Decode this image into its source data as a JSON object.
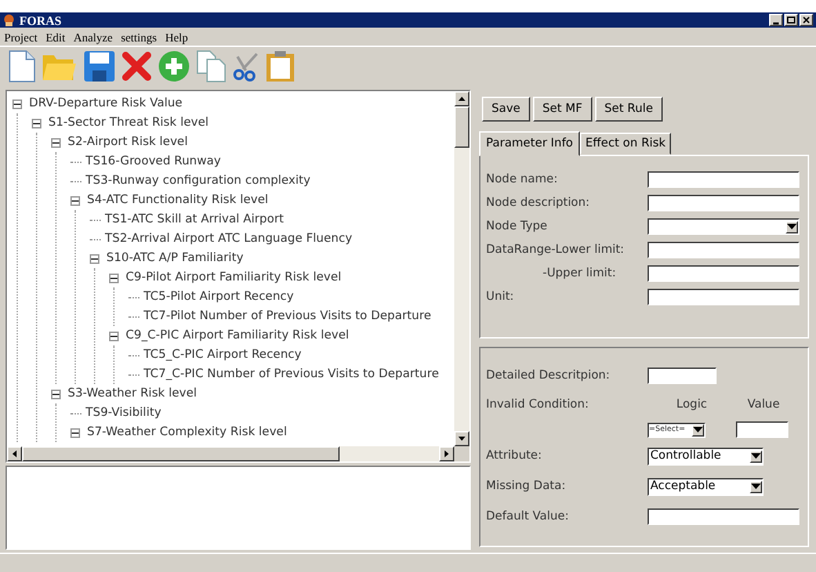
{
  "window": {
    "title": "FORAS"
  },
  "menu": [
    {
      "label": "Project"
    },
    {
      "label": "Edit"
    },
    {
      "label": "Analyze"
    },
    {
      "label": "settings"
    },
    {
      "label": "Help"
    }
  ],
  "tree": [
    {
      "label": "DRV-Departure Risk Value",
      "expanded": true,
      "children": [
        {
          "label": "S1-Sector Threat Risk level",
          "expanded": true,
          "children": [
            {
              "label": "S2-Airport Risk level",
              "expanded": true,
              "children": [
                {
                  "label": "TS16-Grooved Runway"
                },
                {
                  "label": "TS3-Runway configuration complexity"
                },
                {
                  "label": "S4-ATC Functionality Risk level",
                  "expanded": true,
                  "children": [
                    {
                      "label": "TS1-ATC Skill at Arrival Airport"
                    },
                    {
                      "label": "TS2-Arrival Airport ATC Language Fluency"
                    },
                    {
                      "label": "S10-ATC A/P Familiarity",
                      "expanded": true,
                      "children": [
                        {
                          "label": "C9-Pilot Airport Familiarity Risk level",
                          "expanded": true,
                          "children": [
                            {
                              "label": "TC5-Pilot Airport Recency"
                            },
                            {
                              "label": "TC7-Pilot Number of Previous Visits to Departure"
                            }
                          ]
                        },
                        {
                          "label": "C9_C-PIC Airport Familiarity Risk level",
                          "expanded": true,
                          "children": [
                            {
                              "label": "TC5_C-PIC Airport Recency"
                            },
                            {
                              "label": "TC7_C-PIC Number of Previous Visits to Departure"
                            }
                          ]
                        }
                      ]
                    }
                  ]
                }
              ]
            },
            {
              "label": "S3-Weather Risk level",
              "expanded": true,
              "children": [
                {
                  "label": "TS9-Visibility"
                },
                {
                  "label": "S7-Weather Complexity Risk level",
                  "expanded": true
                }
              ]
            }
          ]
        }
      ]
    }
  ],
  "actions": [
    "Save",
    "Set MF",
    "Set Rule"
  ],
  "tabs": [
    {
      "label": "Parameter Info",
      "selected": true
    },
    {
      "label": "Effect on Risk",
      "selected": false
    }
  ],
  "parameter_fields": [
    {
      "label": "Node name:",
      "kind": "text",
      "continuation": false
    },
    {
      "label": "Node description:",
      "kind": "text",
      "continuation": false
    },
    {
      "label": "Node Type",
      "kind": "select",
      "continuation": false
    },
    {
      "label": "DataRange-Lower limit:",
      "kind": "text",
      "continuation": false
    },
    {
      "label": "-Upper limit:",
      "kind": "text",
      "continuation": true
    },
    {
      "label": "Unit:",
      "kind": "text",
      "continuation": false
    }
  ],
  "details": [
    {
      "label": "Detailed Descritpion:",
      "kind": "short_text"
    },
    {
      "label": "Invalid Condition:",
      "kind": "condition",
      "logic_header": "Logic",
      "value_header": "Value",
      "logic_value": "=Select="
    },
    {
      "label": "Attribute:",
      "kind": "select",
      "value": "Controllable"
    },
    {
      "label": "Missing Data:",
      "kind": "select",
      "value": "Acceptable"
    },
    {
      "label": "Default Value:",
      "kind": "text"
    }
  ]
}
